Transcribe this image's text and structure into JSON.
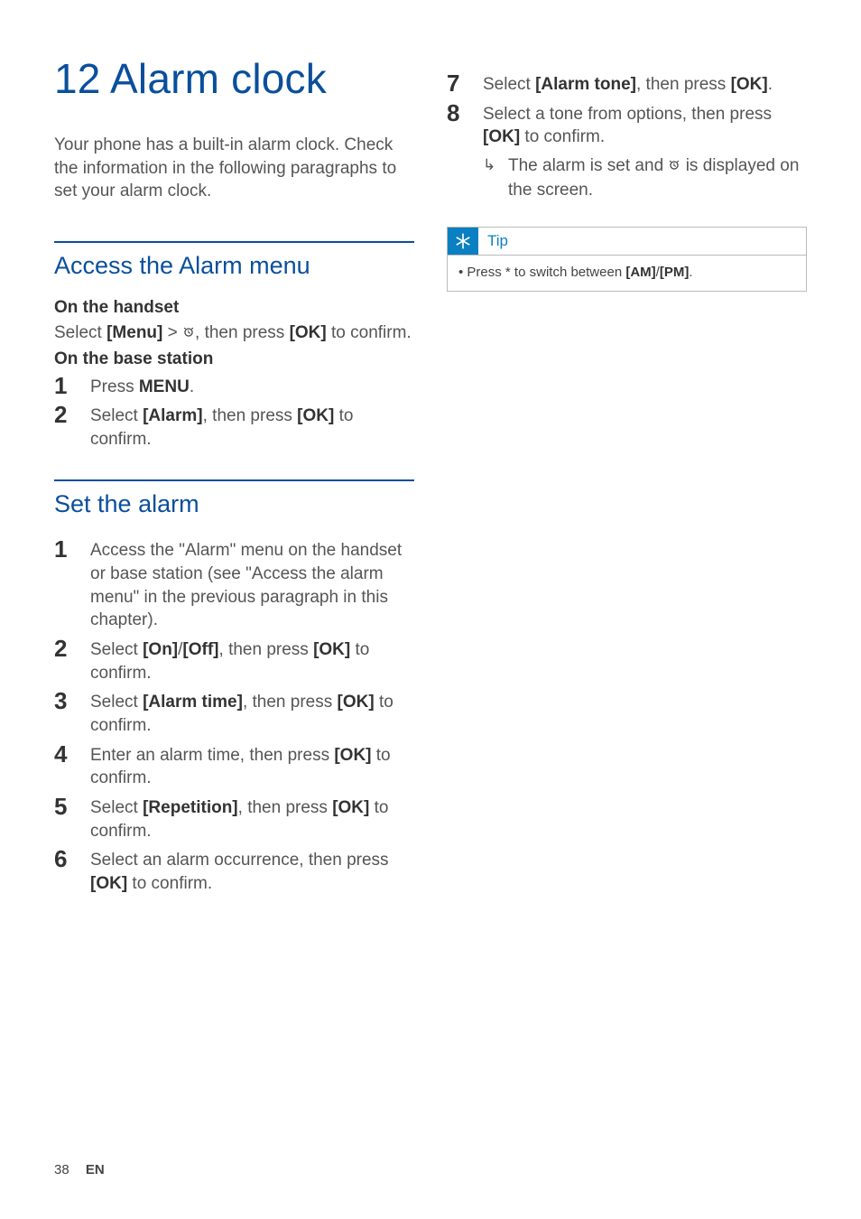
{
  "chapter": {
    "number": "12",
    "title": "Alarm clock"
  },
  "intro": "Your phone has a built-in alarm clock. Check the information in the following paragraphs to set your alarm clock.",
  "section_access": {
    "title": "Access the Alarm menu",
    "handset_label": "On the handset",
    "handset_line_a": "Select ",
    "handset_line_b": "[Menu]",
    "handset_line_c": " > ",
    "handset_line_d": ", then press ",
    "handset_line_e": "[OK]",
    "handset_line_f": " to confirm.",
    "base_label": "On the base station",
    "step1_a": "Press ",
    "step1_b": "MENU",
    "step1_c": ".",
    "step2_a": "Select ",
    "step2_b": "[Alarm]",
    "step2_c": ", then press ",
    "step2_d": "[OK]",
    "step2_e": " to confirm."
  },
  "section_set": {
    "title": "Set the alarm",
    "s1": "Access the \"Alarm\" menu on the handset or base station (see \"Access the alarm menu\" in the previous paragraph in this chapter).",
    "s2_a": "Select ",
    "s2_b": "[On]",
    "s2_c": "/",
    "s2_d": "[Off]",
    "s2_e": ", then press ",
    "s2_f": "[OK]",
    "s2_g": " to confirm.",
    "s3_a": "Select ",
    "s3_b": "[Alarm time]",
    "s3_c": ", then press ",
    "s3_d": "[OK]",
    "s3_e": " to confirm.",
    "s4_a": "Enter an alarm time, then press ",
    "s4_b": "[OK]",
    "s4_c": " to confirm.",
    "s5_a": "Select ",
    "s5_b": "[Repetition]",
    "s5_c": ", then press ",
    "s5_d": "[OK]",
    "s5_e": " to confirm.",
    "s6_a": "Select an alarm occurrence, then press ",
    "s6_b": "[OK]",
    "s6_c": " to confirm."
  },
  "right": {
    "s7_a": "Select ",
    "s7_b": "[Alarm tone]",
    "s7_c": ", then press ",
    "s7_d": "[OK]",
    "s7_e": ".",
    "s8_a": "Select a tone from options, then press ",
    "s8_b": "[OK]",
    "s8_c": " to confirm.",
    "result_a": "The alarm is set and ",
    "result_b": " is displayed on the screen."
  },
  "tip": {
    "label": "Tip",
    "line_a": "Press * to switch between ",
    "line_b": "[AM]",
    "line_c": "/",
    "line_d": "[PM]",
    "line_e": "."
  },
  "footer": {
    "page": "38",
    "lang": "EN"
  },
  "nums": {
    "n1": "1",
    "n2": "2",
    "n3": "3",
    "n4": "4",
    "n5": "5",
    "n6": "6",
    "n7": "7",
    "n8": "8"
  }
}
